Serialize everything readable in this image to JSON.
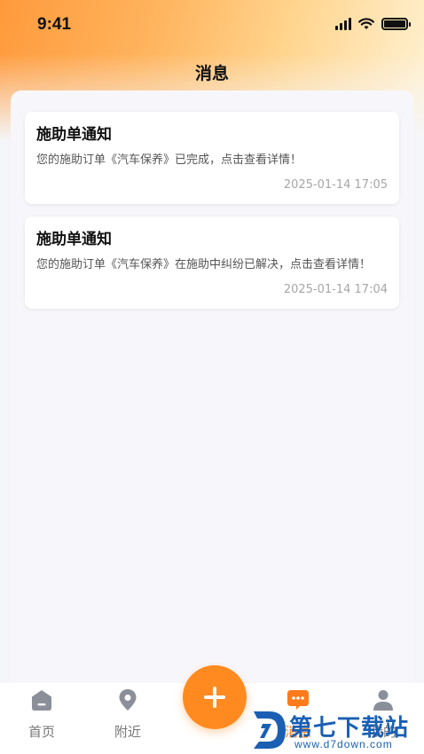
{
  "status_bar": {
    "time": "9:41"
  },
  "header": {
    "title": "消息"
  },
  "messages": [
    {
      "title": "施助单通知",
      "body": "您的施助订单《汽车保养》已完成，点击查看详情！",
      "time": "2025-01-14 17:05"
    },
    {
      "title": "施助单通知",
      "body": "您的施助订单《汽车保养》在施助中纠纷已解决，点击查看详情！",
      "time": "2025-01-14 17:04"
    }
  ],
  "tabbar": {
    "items": [
      {
        "label": "首页",
        "icon": "home-icon"
      },
      {
        "label": "附近",
        "icon": "location-pin-icon"
      },
      {
        "label": "消息",
        "icon": "chat-bubble-icon",
        "active": true
      },
      {
        "label": "我的",
        "icon": "user-icon"
      }
    ],
    "fab_icon": "plus-icon"
  },
  "watermark": {
    "brand": "第七下载站",
    "url": "www.d7down.com"
  },
  "colors": {
    "accent": "#ff8a1f",
    "tab_active": "#ff7a1a",
    "tab_inactive": "#8a8f99"
  }
}
